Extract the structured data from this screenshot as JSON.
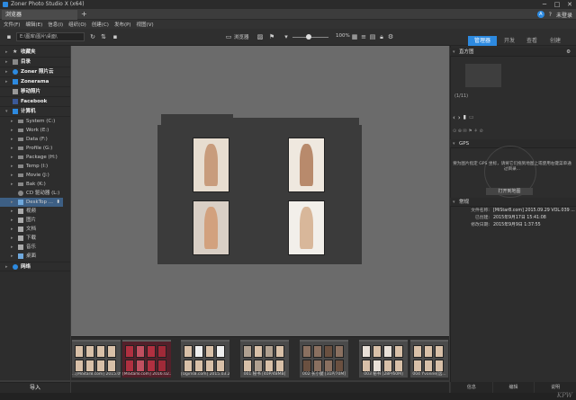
{
  "window": {
    "title": "Zoner Photo Studio X (x64)",
    "minimize": "─",
    "maximize": "□",
    "close": "✕"
  },
  "tab": {
    "label": "浏览器",
    "plus": "+"
  },
  "user": {
    "avatar": "A",
    "help": "?",
    "name": "未登录"
  },
  "menu": [
    "文件(F)",
    "编辑(E)",
    "信息(I)",
    "组织(O)",
    "创建(C)",
    "发布(P)",
    "视图(V)"
  ],
  "toolbar": {
    "path": "E:\\图库\\图片\\桌面\\",
    "view_label": "浏览器",
    "zoom": "100%"
  },
  "modes": [
    {
      "label": "管理器",
      "active": true
    },
    {
      "label": "开发",
      "active": false
    },
    {
      "label": "查看",
      "active": false
    },
    {
      "label": "创建",
      "active": false
    }
  ],
  "sidebar": {
    "items": [
      {
        "label": "收藏夹",
        "type": "head"
      },
      {
        "label": "目录",
        "type": "head"
      },
      {
        "label": "Zoner 照片云",
        "type": "head"
      },
      {
        "label": "Zonerama",
        "type": "head"
      },
      {
        "label": "移动照片",
        "type": "head"
      },
      {
        "label": "Facebook",
        "type": "head"
      },
      {
        "label": "计算机",
        "type": "head"
      },
      {
        "label": "System (C:)",
        "type": "sub"
      },
      {
        "label": "Work (E:)",
        "type": "sub"
      },
      {
        "label": "Data (F:)",
        "type": "sub"
      },
      {
        "label": "Profile (G:)",
        "type": "sub"
      },
      {
        "label": "Package (H:)",
        "type": "sub"
      },
      {
        "label": "Temp (I:)",
        "type": "sub"
      },
      {
        "label": "Movie (J:)",
        "type": "sub"
      },
      {
        "label": "Bak (K:)",
        "type": "sub"
      },
      {
        "label": "CD 驱动器 (L:)",
        "type": "sub"
      },
      {
        "label": "DeskTop ...",
        "type": "sel"
      },
      {
        "label": "视频",
        "type": "sub"
      },
      {
        "label": "图片",
        "type": "sub"
      },
      {
        "label": "文档",
        "type": "sub"
      },
      {
        "label": "下载",
        "type": "sub"
      },
      {
        "label": "音乐",
        "type": "sub"
      },
      {
        "label": "桌面",
        "type": "sub"
      },
      {
        "label": "网络",
        "type": "head"
      }
    ],
    "import_label": "导入"
  },
  "filmstrip": [
    "...[MiStar8.com] 2015.09.15 VOL...",
    "[MiStar8.com] 2016.02.22 VOL...",
    "[Ugirls8.com] 2015.03.21 NO...",
    "001 秘书 [40P/48MB]",
    "002 长小腿 [31P/70M]",
    "003 秘书 [28P/60M]",
    "004 Yvonne[远..."
  ],
  "right_panel": {
    "histogram": "直方图",
    "counter": "(1/11)",
    "gps": "GPS",
    "gps_text": "要为图片指定 GPS 坐标，请将它们拖到地图上或使用右键菜单通过目录...",
    "gps_button": "打开到地图",
    "properties_title": "常规",
    "properties": [
      {
        "key": "文件名称:",
        "value": "[MiStar8.com] 2015.09.29 VOL.039 ..."
      },
      {
        "key": "已创建:",
        "value": "2015年9月17日 15:41:08"
      },
      {
        "key": "修改日期:",
        "value": "2015年9月9日 1:37:55"
      }
    ],
    "bottom_tabs": [
      "信息",
      "编辑",
      "说明"
    ]
  },
  "watermark": "KPW"
}
